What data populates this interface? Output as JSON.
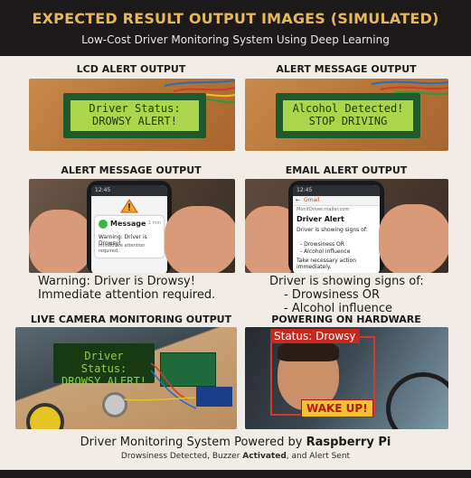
{
  "header": {
    "title": "EXPECTED RESULT OUTPUT IMAGES (SIMULATED)",
    "subtitle": "Low-Cost Driver Monitoring System Using Deep Learning"
  },
  "sections": {
    "lcd": {
      "title": "LCD ALERT OUTPUT",
      "line1": "Driver Status:",
      "line2": "DROWSY ALERT!"
    },
    "alert_message_top": {
      "title": "ALERT MESSAGE OUTPUT",
      "line1": "Alcohol Detected!",
      "line2": "STOP DRIVING"
    },
    "alert_message": {
      "title": "ALERT MESSAGE OUTPUT",
      "time": "12:45",
      "app_label": "Message",
      "app_time": "1 min",
      "screen_line1": "Warning: Driver is Drowsy!",
      "screen_line2": "Immediate attention required.",
      "caption_line1": "Warning: Driver is Drowsy!",
      "caption_line2": "Immediate attention required."
    },
    "email": {
      "title": "EMAIL ALERT OUTPUT",
      "time": "12:45",
      "app_label": "Gmail",
      "sender": "MonitDriver.rnailer.com",
      "subject": "Driver Alert",
      "body1": "Driver is showing signs of:",
      "body2": "- Drowsiness OR",
      "body3": "- Alcohol influence",
      "body4": "Take necessary action immediately.",
      "caption_line1": "Driver is showing signs of:",
      "caption_line2": "- Drowsiness OR",
      "caption_line3": "- Alcohol influence"
    },
    "camera": {
      "title": "LIVE CAMERA MONITORING OUTPUT",
      "lcd_line1": "Driver Status:",
      "lcd_line2": "DROWSY ALERT!"
    },
    "powering": {
      "title": "POWERING ON HARDWARE",
      "status_label": "Status: Drowsy",
      "wake_label": "WAKE UP!"
    }
  },
  "footer": {
    "line1_prefix": "Driver Monitoring System Powered by",
    "line1_brand": "Raspberry Pi",
    "line2_a": "Drowsiness Detected, Buzzer",
    "line2_b": "Activated",
    "line2_c": ", and Alert Sent"
  },
  "colors": {
    "header_bg": "#1c1a1a",
    "title_gold": "#e8b858",
    "lcd_green": "#a9d64a",
    "alert_red": "#c62a1e",
    "alert_yellow": "#f2c232"
  }
}
